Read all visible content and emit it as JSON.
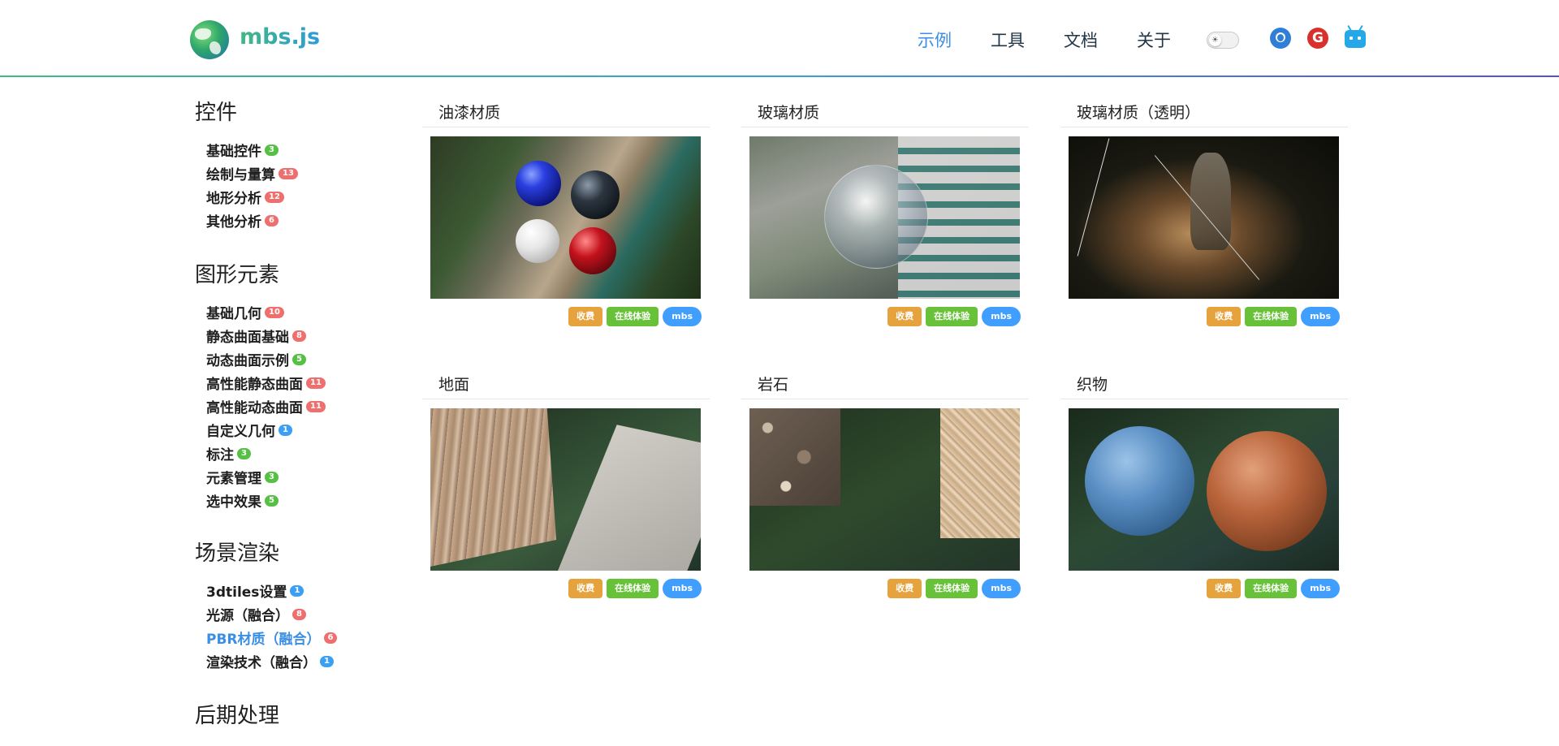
{
  "header": {
    "brand": "mbs.js",
    "nav": [
      "示例",
      "工具",
      "文档",
      "关于"
    ],
    "active_nav": "示例"
  },
  "sidebar": {
    "groups": [
      {
        "title": "控件",
        "items": [
          {
            "label": "基础控件",
            "count": "3",
            "color": "green"
          },
          {
            "label": "绘制与量算",
            "count": "13",
            "color": "red"
          },
          {
            "label": "地形分析",
            "count": "12",
            "color": "red"
          },
          {
            "label": "其他分析",
            "count": "6",
            "color": "red"
          }
        ]
      },
      {
        "title": "图形元素",
        "items": [
          {
            "label": "基础几何",
            "count": "10",
            "color": "red"
          },
          {
            "label": "静态曲面基础",
            "count": "8",
            "color": "red"
          },
          {
            "label": "动态曲面示例",
            "count": "5",
            "color": "green"
          },
          {
            "label": "高性能静态曲面",
            "count": "11",
            "color": "red"
          },
          {
            "label": "高性能动态曲面",
            "count": "11",
            "color": "red"
          },
          {
            "label": "自定义几何",
            "count": "1",
            "color": "blue"
          },
          {
            "label": "标注",
            "count": "3",
            "color": "green"
          },
          {
            "label": "元素管理",
            "count": "3",
            "color": "green"
          },
          {
            "label": "选中效果",
            "count": "5",
            "color": "green"
          }
        ]
      },
      {
        "title": "场景渲染",
        "items": [
          {
            "label": "3dtiles设置",
            "count": "1",
            "color": "blue"
          },
          {
            "label": "光源（融合）",
            "count": "8",
            "color": "red"
          },
          {
            "label": "PBR材质（融合）",
            "count": "6",
            "color": "red",
            "active": true
          },
          {
            "label": "渲染技术（融合）",
            "count": "1",
            "color": "blue"
          }
        ]
      },
      {
        "title": "后期处理",
        "items": []
      }
    ]
  },
  "cards": [
    {
      "title": "油漆材质",
      "tags": [
        "收费",
        "在线体验",
        "mbs"
      ]
    },
    {
      "title": "玻璃材质",
      "tags": [
        "收费",
        "在线体验",
        "mbs"
      ]
    },
    {
      "title": "玻璃材质（透明）",
      "tags": [
        "收费",
        "在线体验",
        "mbs"
      ]
    },
    {
      "title": "地面",
      "tags": [
        "收费",
        "在线体验",
        "mbs"
      ]
    },
    {
      "title": "岩石",
      "tags": [
        "收费",
        "在线体验",
        "mbs"
      ]
    },
    {
      "title": "织物",
      "tags": [
        "收费",
        "在线体验",
        "mbs"
      ]
    }
  ],
  "colors": {
    "accent": "#3a8ee6",
    "badge_green": "#56c045",
    "badge_red": "#ef6e6e",
    "badge_blue": "#3a9ff5",
    "tag_charge": "#e6a23c",
    "tag_online": "#67c23a",
    "tag_mbs": "#409eff"
  },
  "icons": [
    "globe-logo-icon",
    "theme-sun-icon",
    "github-icon",
    "gitee-icon",
    "bilibili-icon"
  ]
}
